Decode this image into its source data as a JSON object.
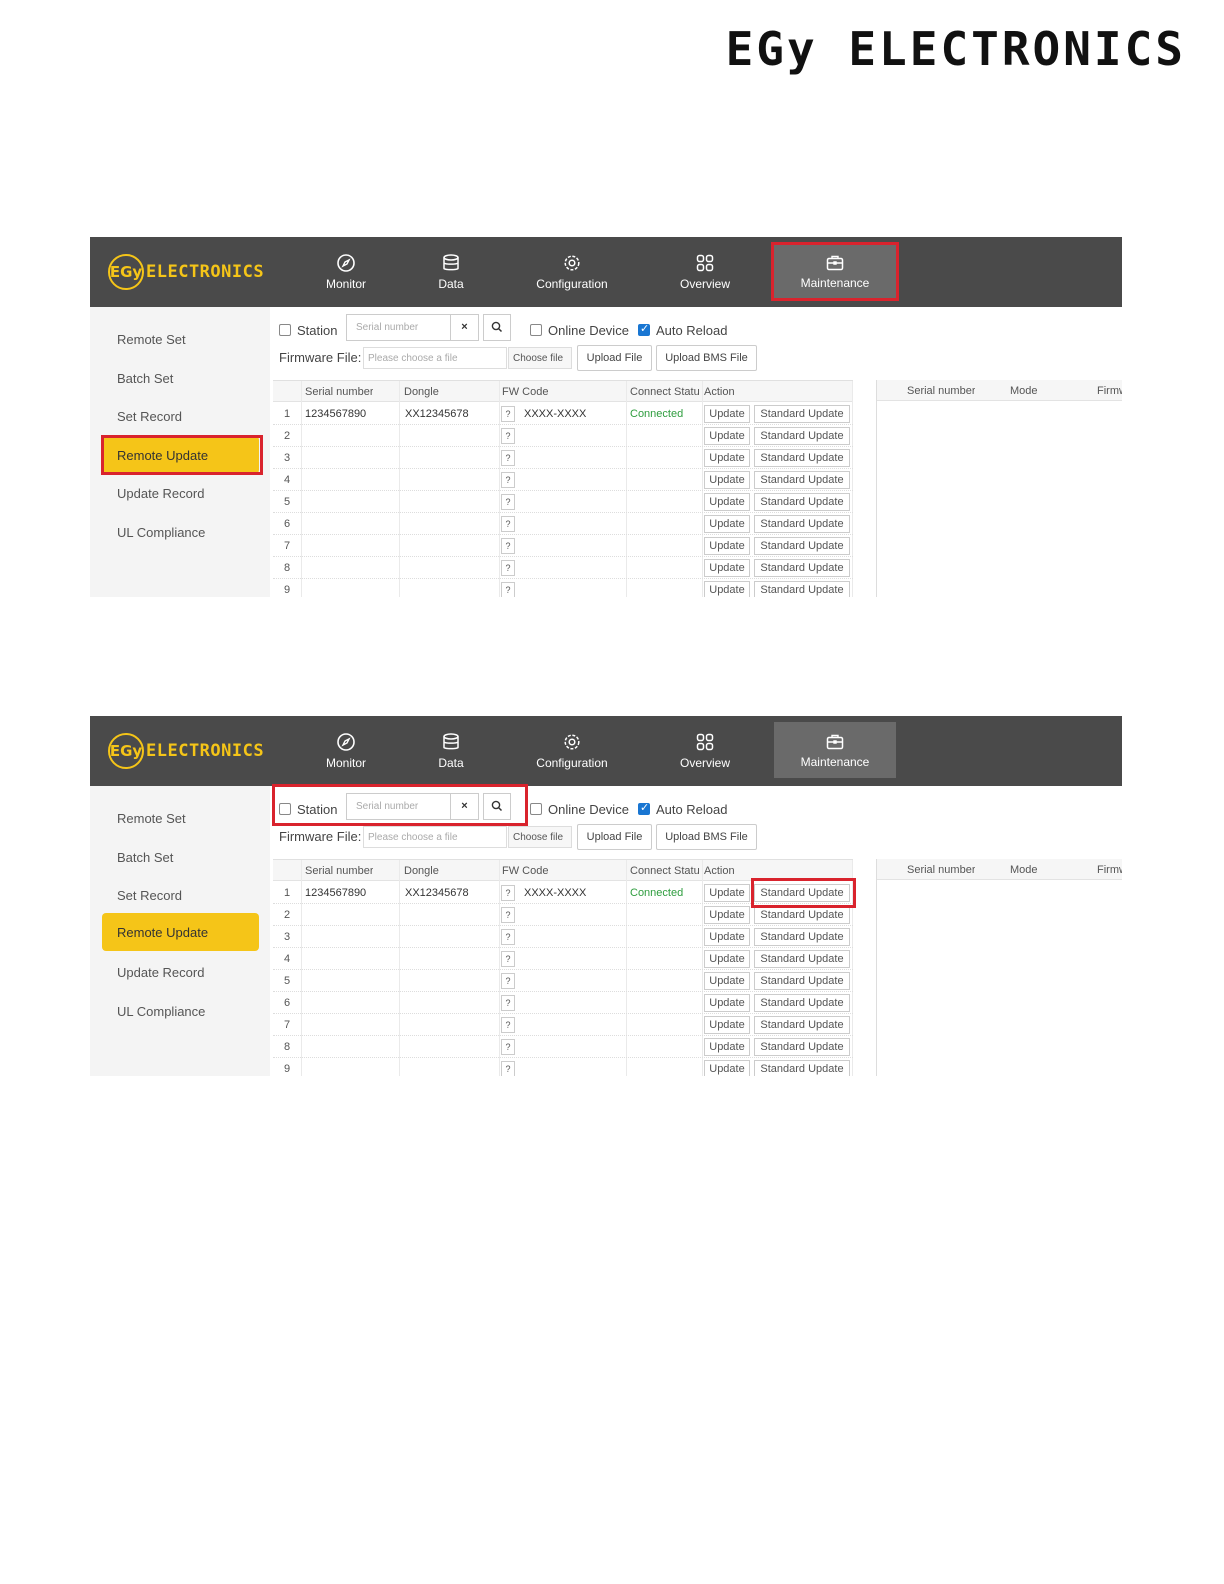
{
  "brand": "EGy ELECTRONICS",
  "screenshots": [
    {
      "logo_mark": "EGy",
      "logo_text": "ELECTRONICS",
      "nav": [
        "Monitor",
        "Data",
        "Configuration",
        "Overview",
        "Maintenance"
      ],
      "active_nav": "Maintenance",
      "sidebar": [
        "Remote Set",
        "Batch Set",
        "Set Record",
        "Remote Update",
        "Update Record",
        "UL Compliance"
      ],
      "active_sidebar": "Remote Update",
      "toolbar": {
        "station_label": "Station",
        "serial_placeholder": "Serial number",
        "clear": "×",
        "online_label": "Online Device",
        "auto_reload_label": "Auto Reload",
        "firmware_label": "Firmware File:",
        "file_placeholder": "Please choose a file",
        "choose_file": "Choose file",
        "upload_file": "Upload File",
        "upload_bms": "Upload BMS File"
      },
      "columns": [
        "Serial number",
        "Dongle",
        "FW Code",
        "Connect Statu",
        "Action"
      ],
      "right_columns": [
        "Serial number",
        "Mode",
        "Firmw"
      ],
      "rows": [
        {
          "num": "1",
          "serial": "1234567890",
          "dongle": "XX12345678",
          "q": "?",
          "fw": "XXXX-XXXX",
          "status": "Connected",
          "update": "Update",
          "standard": "Standard Update"
        },
        {
          "num": "2",
          "serial": "",
          "dongle": "",
          "q": "?",
          "fw": "",
          "status": "",
          "update": "Update",
          "standard": "Standard Update"
        },
        {
          "num": "3",
          "serial": "",
          "dongle": "",
          "q": "?",
          "fw": "",
          "status": "",
          "update": "Update",
          "standard": "Standard Update"
        },
        {
          "num": "4",
          "serial": "",
          "dongle": "",
          "q": "?",
          "fw": "",
          "status": "",
          "update": "Update",
          "standard": "Standard Update"
        },
        {
          "num": "5",
          "serial": "",
          "dongle": "",
          "q": "?",
          "fw": "",
          "status": "",
          "update": "Update",
          "standard": "Standard Update"
        },
        {
          "num": "6",
          "serial": "",
          "dongle": "",
          "q": "?",
          "fw": "",
          "status": "",
          "update": "Update",
          "standard": "Standard Update"
        },
        {
          "num": "7",
          "serial": "",
          "dongle": "",
          "q": "?",
          "fw": "",
          "status": "",
          "update": "Update",
          "standard": "Standard Update"
        },
        {
          "num": "8",
          "serial": "",
          "dongle": "",
          "q": "?",
          "fw": "",
          "status": "",
          "update": "Update",
          "standard": "Standard Update"
        },
        {
          "num": "9",
          "serial": "",
          "dongle": "",
          "q": "?",
          "fw": "",
          "status": "",
          "update": "Update",
          "standard": "Standard Update"
        }
      ],
      "highlights": [
        "Maintenance",
        "Remote Update"
      ]
    },
    {
      "logo_mark": "EGy",
      "logo_text": "ELECTRONICS",
      "nav": [
        "Monitor",
        "Data",
        "Configuration",
        "Overview",
        "Maintenance"
      ],
      "active_nav": "Maintenance",
      "sidebar": [
        "Remote Set",
        "Batch Set",
        "Set Record",
        "Remote Update",
        "Update Record",
        "UL Compliance"
      ],
      "active_sidebar": "Remote Update",
      "toolbar": {
        "station_label": "Station",
        "serial_placeholder": "Serial number",
        "clear": "×",
        "online_label": "Online Device",
        "auto_reload_label": "Auto Reload",
        "firmware_label": "Firmware File:",
        "file_placeholder": "Please choose a file",
        "choose_file": "Choose file",
        "upload_file": "Upload File",
        "upload_bms": "Upload BMS File"
      },
      "columns": [
        "Serial number",
        "Dongle",
        "FW Code",
        "Connect Statu",
        "Action"
      ],
      "right_columns": [
        "Serial number",
        "Mode",
        "Firmw"
      ],
      "rows": [
        {
          "num": "1",
          "serial": "1234567890",
          "dongle": "XX12345678",
          "q": "?",
          "fw": "XXXX-XXXX",
          "status": "Connected",
          "update": "Update",
          "standard": "Standard Update"
        },
        {
          "num": "2",
          "serial": "",
          "dongle": "",
          "q": "?",
          "fw": "",
          "status": "",
          "update": "Update",
          "standard": "Standard Update"
        },
        {
          "num": "3",
          "serial": "",
          "dongle": "",
          "q": "?",
          "fw": "",
          "status": "",
          "update": "Update",
          "standard": "Standard Update"
        },
        {
          "num": "4",
          "serial": "",
          "dongle": "",
          "q": "?",
          "fw": "",
          "status": "",
          "update": "Update",
          "standard": "Standard Update"
        },
        {
          "num": "5",
          "serial": "",
          "dongle": "",
          "q": "?",
          "fw": "",
          "status": "",
          "update": "Update",
          "standard": "Standard Update"
        },
        {
          "num": "6",
          "serial": "",
          "dongle": "",
          "q": "?",
          "fw": "",
          "status": "",
          "update": "Update",
          "standard": "Standard Update"
        },
        {
          "num": "7",
          "serial": "",
          "dongle": "",
          "q": "?",
          "fw": "",
          "status": "",
          "update": "Update",
          "standard": "Standard Update"
        },
        {
          "num": "8",
          "serial": "",
          "dongle": "",
          "q": "?",
          "fw": "",
          "status": "",
          "update": "Update",
          "standard": "Standard Update"
        },
        {
          "num": "9",
          "serial": "",
          "dongle": "",
          "q": "?",
          "fw": "",
          "status": "",
          "update": "Update",
          "standard": "Standard Update"
        }
      ],
      "highlights": [
        "Station search",
        "Standard Update row 1"
      ]
    }
  ],
  "colors": {
    "topbar": "#4a4a4a",
    "accent_yellow": "#f5c518",
    "highlight_red": "#d9232d",
    "connected_green": "#2e9d3e",
    "checkbox_blue": "#1976d2"
  }
}
